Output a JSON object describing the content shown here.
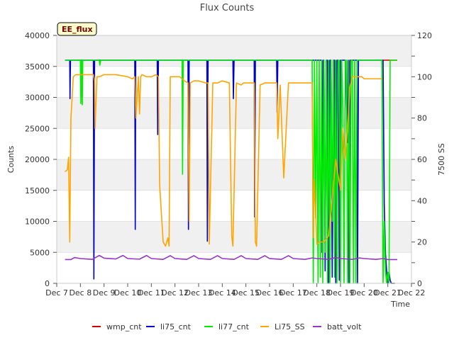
{
  "chart_data": {
    "type": "line",
    "title": "Flux Counts",
    "xlabel": "Time",
    "ylabel": "Counts",
    "y2label": "7500 SS",
    "annotation": "EE_flux",
    "xlim": [
      7,
      22
    ],
    "ylim": [
      0,
      40000
    ],
    "y2lim": [
      0,
      120
    ],
    "x_ticks": [
      7,
      8,
      9,
      10,
      11,
      12,
      13,
      14,
      15,
      16,
      17,
      18,
      19,
      20,
      21,
      22
    ],
    "x_tick_labels": [
      "Dec 7",
      "Dec 8",
      "Dec 9",
      "Dec 10",
      "Dec 11",
      "Dec 12",
      "Dec 13",
      "Dec 14",
      "Dec 15",
      "Dec 16",
      "Dec 17",
      "Dec 18",
      "Dec 19",
      "Dec 20",
      "Dec 21",
      "Dec 22"
    ],
    "y_ticks": [
      0,
      5000,
      10000,
      15000,
      20000,
      25000,
      30000,
      35000,
      40000
    ],
    "y2_ticks": [
      0,
      20,
      40,
      60,
      80,
      100,
      120
    ],
    "grid": true,
    "legend_position": "bottom",
    "series": [
      {
        "name": "wmp_cnt",
        "color": "#cc0000",
        "axis": "left",
        "x": [
          20.8,
          21.4
        ],
        "y": [
          36000,
          36000
        ]
      },
      {
        "name": "li75_cnt",
        "color": "#0000cc",
        "axis": "left",
        "x": [
          7.35,
          7.55,
          7.56,
          7.58,
          7.6,
          8.55,
          8.57,
          8.6,
          8.62,
          8.64,
          10.3,
          10.32,
          10.34,
          10.37,
          10.39,
          11.25,
          11.27,
          11.3,
          11.32,
          11.34,
          12.55,
          12.57,
          12.6,
          12.62,
          12.64,
          13.35,
          13.37,
          13.4,
          13.42,
          13.44,
          14.45,
          14.47,
          14.5,
          14.52,
          14.54,
          15.35,
          15.37,
          15.4,
          15.42,
          15.44,
          16.3,
          16.32,
          16.35,
          16.37,
          16.39,
          18.1,
          18.2,
          18.22,
          18.26,
          18.3,
          18.35,
          18.4,
          18.45,
          18.5,
          18.55,
          18.6,
          18.65,
          18.7,
          18.75,
          18.8,
          18.85,
          18.9,
          18.95,
          19.0,
          19.1,
          19.2,
          19.3,
          19.32,
          19.36,
          19.4,
          19.5,
          19.6,
          19.7,
          19.72,
          19.76,
          19.8,
          20.0,
          20.8,
          20.85,
          20.9,
          20.95,
          21.0,
          21.05,
          21.1,
          21.15,
          21.2,
          21.25,
          21.3
        ],
        "y": [
          36000,
          36000,
          29800,
          36000,
          36000,
          36000,
          700,
          36000,
          36000,
          36000,
          36000,
          8700,
          36000,
          36000,
          36000,
          36000,
          24000,
          36000,
          36000,
          36000,
          36000,
          8700,
          36000,
          36000,
          36000,
          36000,
          6800,
          36000,
          36000,
          36000,
          36000,
          29800,
          36000,
          36000,
          36000,
          36000,
          10700,
          36000,
          36000,
          36000,
          36000,
          27600,
          36000,
          36000,
          36000,
          36000,
          36000,
          5000,
          36000,
          36000,
          2000,
          36000,
          36000,
          0,
          36000,
          36000,
          1000,
          36000,
          36000,
          0,
          36000,
          36000,
          500,
          36000,
          36000,
          36000,
          22700,
          36000,
          0,
          36000,
          36000,
          36000,
          36000,
          0,
          36000,
          36000,
          36000,
          36000,
          12800,
          5000,
          2000,
          0,
          1800,
          500,
          0,
          0,
          0,
          0
        ]
      },
      {
        "name": "li77_cnt",
        "color": "#00ee00",
        "axis": "left",
        "x": [
          7.35,
          8.0,
          8.02,
          8.05,
          8.08,
          8.1,
          8.8,
          8.82,
          8.86,
          8.9,
          11.0,
          12.3,
          12.32,
          12.35,
          12.38,
          12.4,
          17.5,
          17.8,
          17.85,
          17.9,
          17.95,
          18.0,
          18.05,
          18.1,
          18.15,
          18.2,
          18.25,
          18.3,
          18.35,
          18.4,
          18.45,
          18.5,
          18.55,
          18.6,
          18.65,
          18.7,
          18.75,
          18.8,
          18.85,
          18.9,
          18.95,
          19.0,
          19.05,
          19.1,
          19.15,
          19.2,
          19.25,
          19.3,
          19.35,
          19.4,
          19.45,
          19.5,
          19.55,
          19.6,
          19.65,
          19.7,
          19.75,
          19.8,
          19.85,
          19.9,
          20.7,
          20.75,
          20.8,
          20.85,
          20.9,
          20.95,
          21.0,
          21.05,
          21.1,
          21.4
        ],
        "y": [
          36000,
          36000,
          29000,
          36000,
          28800,
          36000,
          36000,
          35200,
          36000,
          36000,
          36000,
          36000,
          17600,
          36000,
          36000,
          36000,
          36000,
          36000,
          0,
          36000,
          10500,
          36000,
          0,
          36000,
          1000,
          36000,
          0,
          36000,
          5000,
          36000,
          0,
          36000,
          0,
          36000,
          10000,
          36000,
          1000,
          36000,
          0,
          36000,
          36000,
          0,
          36000,
          28000,
          0,
          36000,
          36000,
          0,
          36000,
          0,
          36000,
          36000,
          0,
          36000,
          0,
          36000,
          36000,
          36000,
          36000,
          36000,
          36000,
          36000,
          0,
          10000,
          2000,
          0,
          1800,
          0,
          36000,
          36000
        ]
      },
      {
        "name": "Li75_SS",
        "color": "#ffa500",
        "axis": "right",
        "x": [
          7.35,
          7.45,
          7.5,
          7.55,
          7.6,
          7.7,
          7.8,
          7.9,
          8.0,
          8.1,
          8.3,
          8.55,
          8.6,
          8.62,
          8.7,
          8.8,
          9.0,
          9.5,
          10.0,
          10.2,
          10.3,
          10.35,
          10.45,
          10.5,
          10.55,
          10.6,
          10.8,
          11.0,
          11.2,
          11.3,
          11.35,
          11.5,
          11.6,
          11.7,
          11.75,
          11.8,
          12.2,
          12.4,
          12.55,
          12.6,
          12.65,
          12.8,
          13.0,
          13.3,
          13.4,
          13.45,
          13.6,
          13.8,
          14.0,
          14.3,
          14.4,
          14.45,
          14.6,
          14.8,
          14.9,
          15.2,
          15.35,
          15.4,
          15.45,
          15.6,
          15.8,
          16.2,
          16.3,
          16.35,
          16.45,
          16.6,
          16.8,
          17.2,
          17.5,
          17.7,
          17.8,
          17.85,
          17.9,
          18.0,
          18.1,
          18.3,
          18.5,
          18.8,
          19.0,
          19.1,
          19.2,
          19.3,
          19.4,
          19.5,
          19.6,
          19.7,
          19.8,
          19.9,
          20.0,
          20.3,
          20.6,
          20.7,
          20.75
        ],
        "y": [
          54,
          55,
          61,
          20,
          80,
          100,
          101,
          101,
          101,
          101,
          101,
          101,
          98,
          75,
          100,
          100,
          101,
          101,
          100,
          99,
          100,
          80,
          100,
          82,
          100,
          101,
          100,
          100,
          101,
          100,
          48,
          20,
          18,
          22,
          18,
          100,
          100,
          98,
          97,
          30,
          97,
          98,
          98,
          97,
          97,
          19,
          97,
          97,
          98,
          97,
          23,
          18,
          97,
          96,
          97,
          97,
          97,
          20,
          18,
          96,
          97,
          97,
          97,
          70,
          96,
          51,
          97,
          97,
          97,
          97,
          97,
          22,
          50,
          19,
          20,
          20,
          23,
          60,
          45,
          75,
          60,
          75,
          95,
          100,
          100,
          100,
          100,
          100,
          99,
          99,
          99,
          99,
          99
        ]
      },
      {
        "name": "batt_volt",
        "color": "#9933cc",
        "axis": "right",
        "x": [
          7.35,
          7.6,
          7.75,
          8.0,
          8.5,
          8.8,
          9.0,
          9.5,
          9.8,
          10.0,
          10.5,
          10.8,
          11.0,
          11.5,
          11.8,
          12.0,
          12.5,
          12.8,
          13.0,
          13.5,
          13.8,
          14.0,
          14.5,
          14.8,
          15.0,
          15.5,
          15.8,
          16.0,
          16.5,
          16.8,
          17.0,
          17.5,
          17.8,
          18.0,
          18.5,
          18.8,
          19.0,
          19.5,
          19.8,
          20.0,
          20.5,
          20.8,
          21.0,
          21.4
        ],
        "y": [
          11.5,
          11.5,
          12.5,
          12.0,
          11.6,
          13.5,
          12.2,
          11.8,
          13.5,
          12.0,
          11.7,
          13.5,
          12.0,
          11.6,
          13.4,
          12.0,
          11.6,
          13.4,
          12.0,
          11.6,
          13.4,
          12.0,
          11.6,
          13.4,
          12.0,
          11.6,
          13.4,
          12.0,
          11.6,
          13.4,
          12.0,
          11.6,
          12.3,
          12.0,
          11.6,
          12.5,
          12.0,
          11.6,
          12.3,
          12.0,
          11.6,
          12.0,
          11.5,
          11.5
        ]
      }
    ]
  }
}
